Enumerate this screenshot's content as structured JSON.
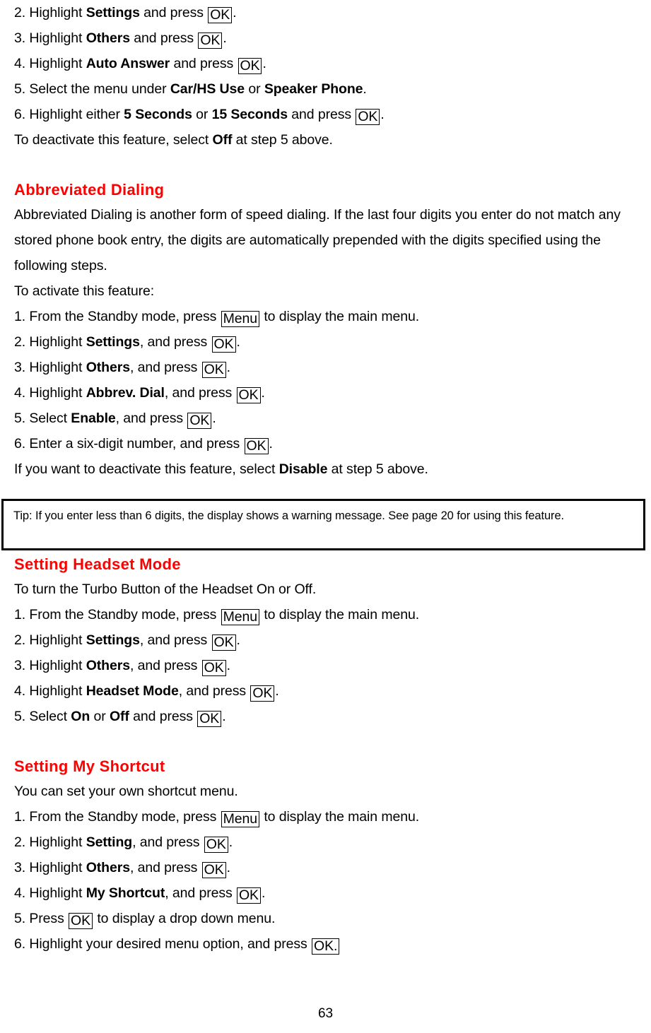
{
  "document": {
    "page_number": "63",
    "heading_color": "#ff0000",
    "text_color": "#000000"
  },
  "top_steps": {
    "step2": {
      "pre": "2. Highlight ",
      "bold": "Settings",
      "mid": " and press ",
      "key": "OK",
      "post": "."
    },
    "step3": {
      "pre": "3. Highlight ",
      "bold": "Others",
      "mid": " and press ",
      "key": "OK",
      "post": "."
    },
    "step4": {
      "pre": "4. Highlight ",
      "bold": "Auto Answer",
      "mid": " and press ",
      "key": "OK",
      "post": "."
    },
    "step5": {
      "pre": "5. Select the menu under ",
      "bold": "Car/HS Use",
      "mid": " or ",
      "bold2": "Speaker Phone",
      "post": "."
    },
    "step6": {
      "pre": "6. Highlight either ",
      "bold": "5 Seconds",
      "mid": " or ",
      "bold2": "15 Seconds",
      "mid2": " and press ",
      "key": "OK",
      "post": "."
    },
    "deactivate": {
      "pre": "To deactivate this feature, select ",
      "bold": "Off",
      "post": " at step 5 above."
    }
  },
  "abbreviated_dialing": {
    "heading": "Abbreviated Dialing",
    "intro": "Abbreviated Dialing is another form of speed dialing. If the last four digits you enter do not match any stored phone book entry, the digits are automatically prepended with the digits specified using the following steps.",
    "activate_label": "To activate this feature:",
    "step1": {
      "pre": "1. From the Standby mode, press ",
      "key": "Menu",
      "post": " to display the main menu."
    },
    "step2": {
      "pre": "2. Highlight ",
      "bold": "Settings",
      "mid": ", and press ",
      "key": "OK",
      "post": "."
    },
    "step3": {
      "pre": "3. Highlight ",
      "bold": "Others",
      "mid": ", and press ",
      "key": "OK",
      "post": "."
    },
    "step4": {
      "pre": "4. Highlight ",
      "bold": "Abbrev. Dial",
      "mid": ", and press ",
      "key": "OK",
      "post": "."
    },
    "step5": {
      "pre": "5. Select ",
      "bold": "Enable",
      "mid": ", and press ",
      "key": "OK",
      "post": "."
    },
    "step6": {
      "pre": "6. Enter a six-digit number, and press ",
      "key": "OK",
      "post": "."
    },
    "deactivate": {
      "pre": "If you want to deactivate this feature, select ",
      "bold": "Disable",
      "post": " at step 5 above."
    },
    "tip": "Tip: If you enter less than 6 digits, the display shows a warning message. See page 20 for using this feature."
  },
  "headset_mode": {
    "heading": "Setting Headset Mode",
    "intro": "To turn the Turbo Button of the Headset On or Off.",
    "step1": {
      "pre": "1. From the Standby mode, press ",
      "key": "Menu",
      "post": " to display the main menu."
    },
    "step2": {
      "pre": "2. Highlight ",
      "bold": "Settings",
      "mid": ", and press ",
      "key": "OK",
      "post": "."
    },
    "step3": {
      "pre": "3. Highlight ",
      "bold": "Others",
      "mid": ", and press ",
      "key": "OK",
      "post": "."
    },
    "step4": {
      "pre": "4. Highlight ",
      "bold": "Headset Mode",
      "mid": ", and press ",
      "key": "OK",
      "post": "."
    },
    "step5": {
      "pre": "5. Select ",
      "bold": "On",
      "mid": " or ",
      "bold2": "Off",
      "mid2": " and press ",
      "key": "OK",
      "post": "."
    }
  },
  "my_shortcut": {
    "heading": "Setting My Shortcut",
    "intro": "You can set your own shortcut menu.",
    "step1": {
      "pre": "1. From the Standby mode, press ",
      "key": "Menu",
      "post": " to display the main menu."
    },
    "step2": {
      "pre": "2. Highlight ",
      "bold": "Setting",
      "mid": ", and press ",
      "key": "OK",
      "post": "."
    },
    "step3": {
      "pre": "3. Highlight ",
      "bold": "Others",
      "mid": ", and press ",
      "key": "OK",
      "post": "."
    },
    "step4": {
      "pre": "4. Highlight ",
      "bold": "My Shortcut",
      "mid": ", and press ",
      "key": "OK",
      "post": "."
    },
    "step5": {
      "pre": "5. Press ",
      "key": "OK",
      "post": " to display a drop down menu."
    },
    "step6": {
      "pre": "6. Highlight your desired menu option, and press ",
      "key": "OK.",
      "post": ""
    }
  }
}
